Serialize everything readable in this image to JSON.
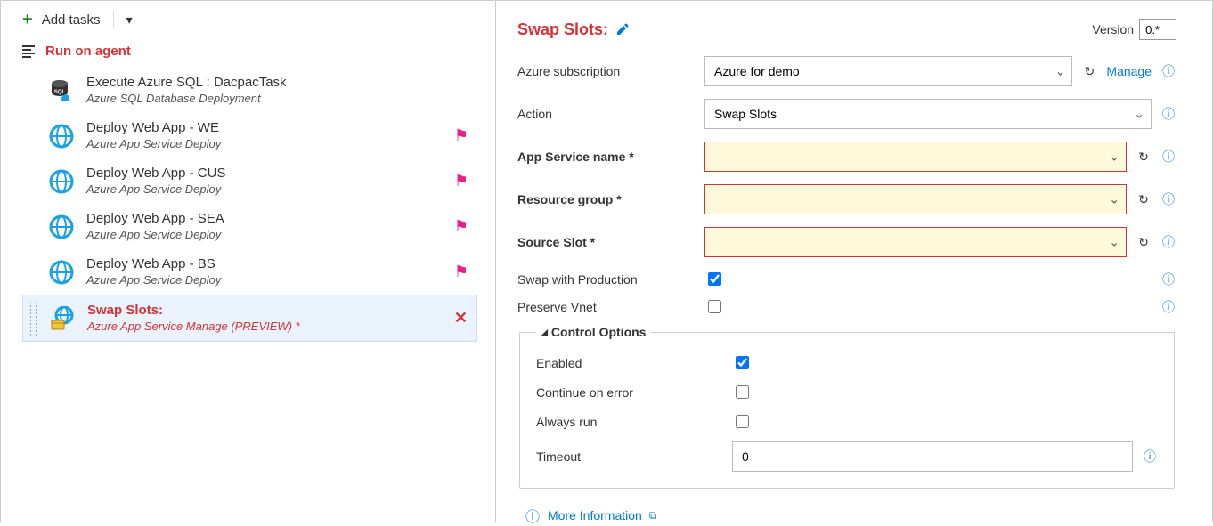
{
  "toolbar": {
    "add_tasks": "Add tasks"
  },
  "agent": {
    "label": "Run on agent"
  },
  "tasks": [
    {
      "title": "Execute Azure SQL : DacpacTask",
      "subtitle": "Azure SQL Database Deployment",
      "flag": false,
      "selected": false,
      "icon": "sql"
    },
    {
      "title": "Deploy Web App - WE",
      "subtitle": "Azure App Service Deploy",
      "flag": true,
      "selected": false,
      "icon": "globe"
    },
    {
      "title": "Deploy Web App - CUS",
      "subtitle": "Azure App Service Deploy",
      "flag": true,
      "selected": false,
      "icon": "globe"
    },
    {
      "title": "Deploy Web App - SEA",
      "subtitle": "Azure App Service Deploy",
      "flag": true,
      "selected": false,
      "icon": "globe"
    },
    {
      "title": "Deploy Web App - BS",
      "subtitle": "Azure App Service Deploy",
      "flag": true,
      "selected": false,
      "icon": "globe"
    },
    {
      "title": "Swap Slots:",
      "subtitle": "Azure App Service Manage (PREVIEW) *",
      "flag": false,
      "selected": true,
      "icon": "manage"
    }
  ],
  "details": {
    "title": "Swap Slots:",
    "version_label": "Version",
    "version_value": "0.*",
    "manage_link": "Manage",
    "fields": {
      "subscription": {
        "label": "Azure subscription",
        "value": "Azure for demo"
      },
      "action": {
        "label": "Action",
        "value": "Swap Slots"
      },
      "app_service": {
        "label": "App Service name *",
        "value": ""
      },
      "resource_group": {
        "label": "Resource group *",
        "value": ""
      },
      "source_slot": {
        "label": "Source Slot *",
        "value": ""
      },
      "swap_prod": {
        "label": "Swap with Production",
        "checked": true
      },
      "preserve_vnet": {
        "label": "Preserve Vnet",
        "checked": false
      }
    },
    "control_options": {
      "legend": "Control Options",
      "enabled": {
        "label": "Enabled",
        "checked": true
      },
      "continue": {
        "label": "Continue on error",
        "checked": false
      },
      "always": {
        "label": "Always run",
        "checked": false
      },
      "timeout": {
        "label": "Timeout",
        "value": "0"
      }
    },
    "more_info": "More Information"
  }
}
